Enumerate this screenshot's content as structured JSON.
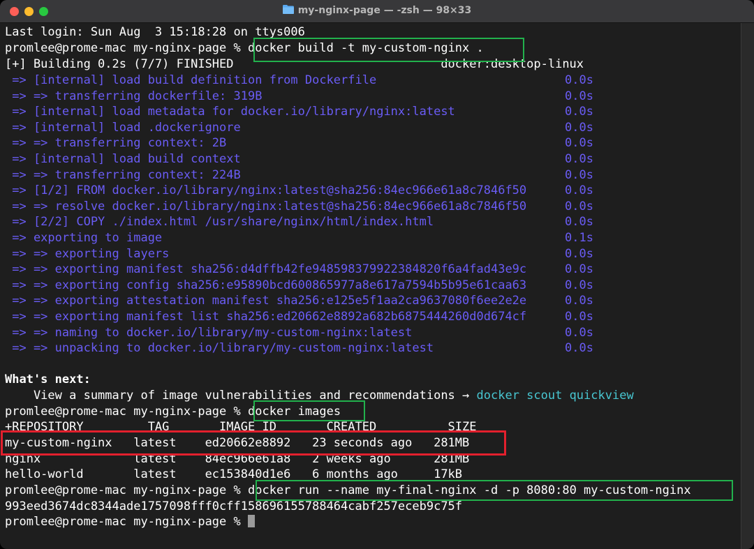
{
  "window": {
    "title": "my-nginx-page — -zsh — 98×33"
  },
  "terminal": {
    "last_login": "Last login: Sun Aug  3 15:18:28 on ttys006",
    "prompt": "promlee@prome-mac my-nginx-page % ",
    "cmd_build": "docker build -t my-custom-nginx .",
    "build_status": "[+] Building 0.2s (7/7) FINISHED                             docker:desktop-linux",
    "build_steps": [
      {
        "text": " => [internal] load build definition from Dockerfile",
        "time": "0.0s"
      },
      {
        "text": " => => transferring dockerfile: 319B",
        "time": "0.0s"
      },
      {
        "text": " => [internal] load metadata for docker.io/library/nginx:latest",
        "time": "0.0s"
      },
      {
        "text": " => [internal] load .dockerignore",
        "time": "0.0s"
      },
      {
        "text": " => => transferring context: 2B",
        "time": "0.0s"
      },
      {
        "text": " => [internal] load build context",
        "time": "0.0s"
      },
      {
        "text": " => => transferring context: 224B",
        "time": "0.0s"
      },
      {
        "text": " => [1/2] FROM docker.io/library/nginx:latest@sha256:84ec966e61a8c7846f50",
        "time": "0.0s"
      },
      {
        "text": " => => resolve docker.io/library/nginx:latest@sha256:84ec966e61a8c7846f50",
        "time": "0.0s"
      },
      {
        "text": " => [2/2] COPY ./index.html /usr/share/nginx/html/index.html",
        "time": "0.0s"
      },
      {
        "text": " => exporting to image",
        "time": "0.1s"
      },
      {
        "text": " => => exporting layers",
        "time": "0.0s"
      },
      {
        "text": " => => exporting manifest sha256:d4dffb42fe948598379922384820f6a4fad43e9c",
        "time": "0.0s"
      },
      {
        "text": " => => exporting config sha256:e95890bcd600865977a8e617a7594b5b95e61caa63",
        "time": "0.0s"
      },
      {
        "text": " => => exporting attestation manifest sha256:e125e5f1aa2ca9637080f6ee2e2e",
        "time": "0.0s"
      },
      {
        "text": " => => exporting manifest list sha256:ed20662e8892a682b6875444260d0d674cf",
        "time": "0.0s"
      },
      {
        "text": " => => naming to docker.io/library/my-custom-nginx:latest",
        "time": "0.0s"
      },
      {
        "text": " => => unpacking to docker.io/library/my-custom-nginx:latest",
        "time": "0.0s"
      }
    ],
    "whats_next": "What's next:",
    "hint_text": "    View a summary of image vulnerabilities and recommendations → ",
    "hint_cmd": "docker scout quickview",
    "cmd_images": "docker images",
    "images_header": "+REPOSITORY         TAG       IMAGE ID       CREATED          SIZE",
    "images_rows": [
      "my-custom-nginx   latest    ed20662e8892   23 seconds ago   281MB",
      "nginx             latest    84ec966e61a8   2 weeks ago      281MB",
      "hello-world       latest    ec153840d1e6   6 months ago     17kB"
    ],
    "cmd_run": "docker run --name my-final-nginx -d -p 8080:80 my-custom-nginx",
    "container_id": "993eed3674dc8344ade1757098fff0cff158696155788464cabf257eceb9c75f"
  },
  "colors": {
    "step_text": "#6a5cf5",
    "hint_cmd": "#48c6d1",
    "highlight_green": "#22b14c",
    "highlight_red": "#e3202d"
  },
  "icons": {
    "title_icon": "folder-icon"
  }
}
